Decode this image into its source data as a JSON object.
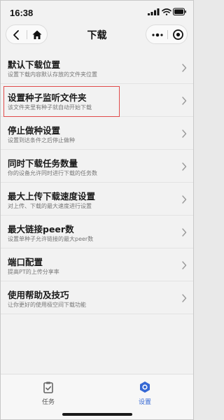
{
  "status_bar": {
    "time": "16:38",
    "icons": [
      "signal-icon",
      "wifi-icon",
      "battery-icon"
    ]
  },
  "nav": {
    "title": "下载",
    "left_buttons": [
      "back-icon",
      "home-icon"
    ],
    "right_buttons": [
      "more-icon",
      "target-icon"
    ]
  },
  "settings": {
    "items": [
      {
        "title": "默认下载位置",
        "desc": "设置下载内容默认存放的文件夹位置"
      },
      {
        "title": "设置种子监听文件夹",
        "desc": "该文件夹里有种子就自动开始下载",
        "highlighted": true
      },
      {
        "title": "停止做种设置",
        "desc": "设置到达条件之后停止做种"
      },
      {
        "title": "同时下载任务数量",
        "desc": "你的设备允许同时进行下载的任务数"
      },
      {
        "title": "最大上传下载速度设置",
        "desc": "对上传、下载的最大速度进行设置"
      },
      {
        "title": "最大链接peer数",
        "desc": "设置单种子允许链接的最大peer数"
      },
      {
        "title": "端口配置",
        "desc": "提高PT的上传分享率"
      },
      {
        "title": "使用帮助及技巧",
        "desc": "让你更好的使用极空间下载功能"
      }
    ]
  },
  "tab_bar": {
    "tabs": [
      {
        "label": "任务",
        "icon": "clipboard-icon",
        "active": false
      },
      {
        "label": "设置",
        "icon": "hexagon-settings-icon",
        "active": true
      }
    ]
  },
  "colors": {
    "accent": "#3568d4",
    "highlight_border": "#e04a4a",
    "background": "#f2f2f2"
  }
}
